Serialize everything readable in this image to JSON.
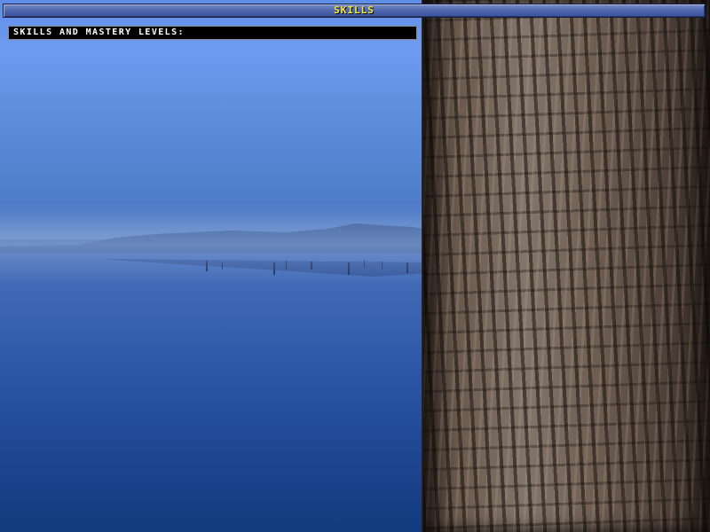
{
  "window": {
    "title": "SKILLS"
  },
  "skills_panel": {
    "header": "SKILLS AND MASTERY LEVELS:"
  },
  "background": {
    "scene": "misty-lake-with-tree-trunk",
    "colors": {
      "sky": "#6f9bf0",
      "lake": "#1d4690",
      "bark": "#6e5e52",
      "title_text": "#f8e838",
      "title_bar": "#4d65ad",
      "panel": "#000000"
    }
  }
}
